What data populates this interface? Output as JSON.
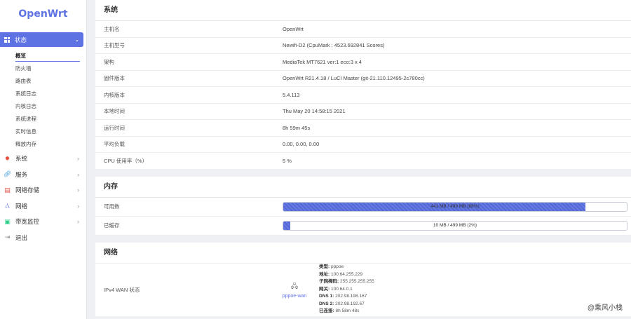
{
  "sidebar": {
    "logo": "OpenWrt",
    "active_menu": "状态",
    "submenu": [
      "概览",
      "防火墙",
      "路由表",
      "系统日志",
      "内核日志",
      "系统进程",
      "实时信息",
      "释放内存"
    ],
    "menus": [
      {
        "label": "系统",
        "icon": "gear-icon",
        "color": "#e74c3c"
      },
      {
        "label": "服务",
        "icon": "link-icon",
        "color": "#3498db"
      },
      {
        "label": "网络存储",
        "icon": "storage-icon",
        "color": "#e74c3c"
      },
      {
        "label": "网络",
        "icon": "network-icon",
        "color": "#5e72e4"
      },
      {
        "label": "带宽监控",
        "icon": "monitor-icon",
        "color": "#2dce89"
      },
      {
        "label": "退出",
        "icon": "logout-icon",
        "color": "#888888"
      }
    ]
  },
  "system": {
    "title": "系统",
    "rows": [
      {
        "k": "主机名",
        "v": "OpenWrt"
      },
      {
        "k": "主机型号",
        "v": "Newifi-D2 (CpuMark : 4523.692841 Scores)"
      },
      {
        "k": "架构",
        "v": "MediaTek MT7621 ver:1 eco:3 x 4"
      },
      {
        "k": "固件版本",
        "v": "OpenWrt R21.4.18 / LuCI Master (git-21.110.12495-2c780cc)"
      },
      {
        "k": "内核版本",
        "v": "5.4.113"
      },
      {
        "k": "本地时间",
        "v": "Thu May 20 14:58:15 2021"
      },
      {
        "k": "运行时间",
        "v": "8h 59m 45s"
      },
      {
        "k": "平均负载",
        "v": "0.00, 0.00, 0.00"
      },
      {
        "k": "CPU 使用率（%）",
        "v": "5 %"
      }
    ]
  },
  "memory": {
    "title": "内存",
    "available_label": "可用数",
    "available_text": "441 MB / 499 MB (88%)",
    "available_pct": 88,
    "cached_label": "已缓存",
    "cached_text": "10 MB / 499 MB (2%)",
    "cached_pct": 2
  },
  "network": {
    "title": "网络",
    "wan_label": "IPv4 WAN 状态",
    "iface": "pppoe-wan",
    "info": [
      {
        "k": "类型:",
        "v": "pppoe"
      },
      {
        "k": "地址:",
        "v": "100.64.255.229"
      },
      {
        "k": "子网掩码:",
        "v": "255.255.255.255"
      },
      {
        "k": "网关:",
        "v": "100.64.0.1"
      },
      {
        "k": "DNS 1:",
        "v": "202.98.198.167"
      },
      {
        "k": "DNS 2:",
        "v": "202.98.192.67"
      },
      {
        "k": "已连接:",
        "v": "8h 58m 48s"
      }
    ]
  },
  "watermark": "@乘风小栈",
  "colors": {
    "accent": "#5e72e4"
  }
}
